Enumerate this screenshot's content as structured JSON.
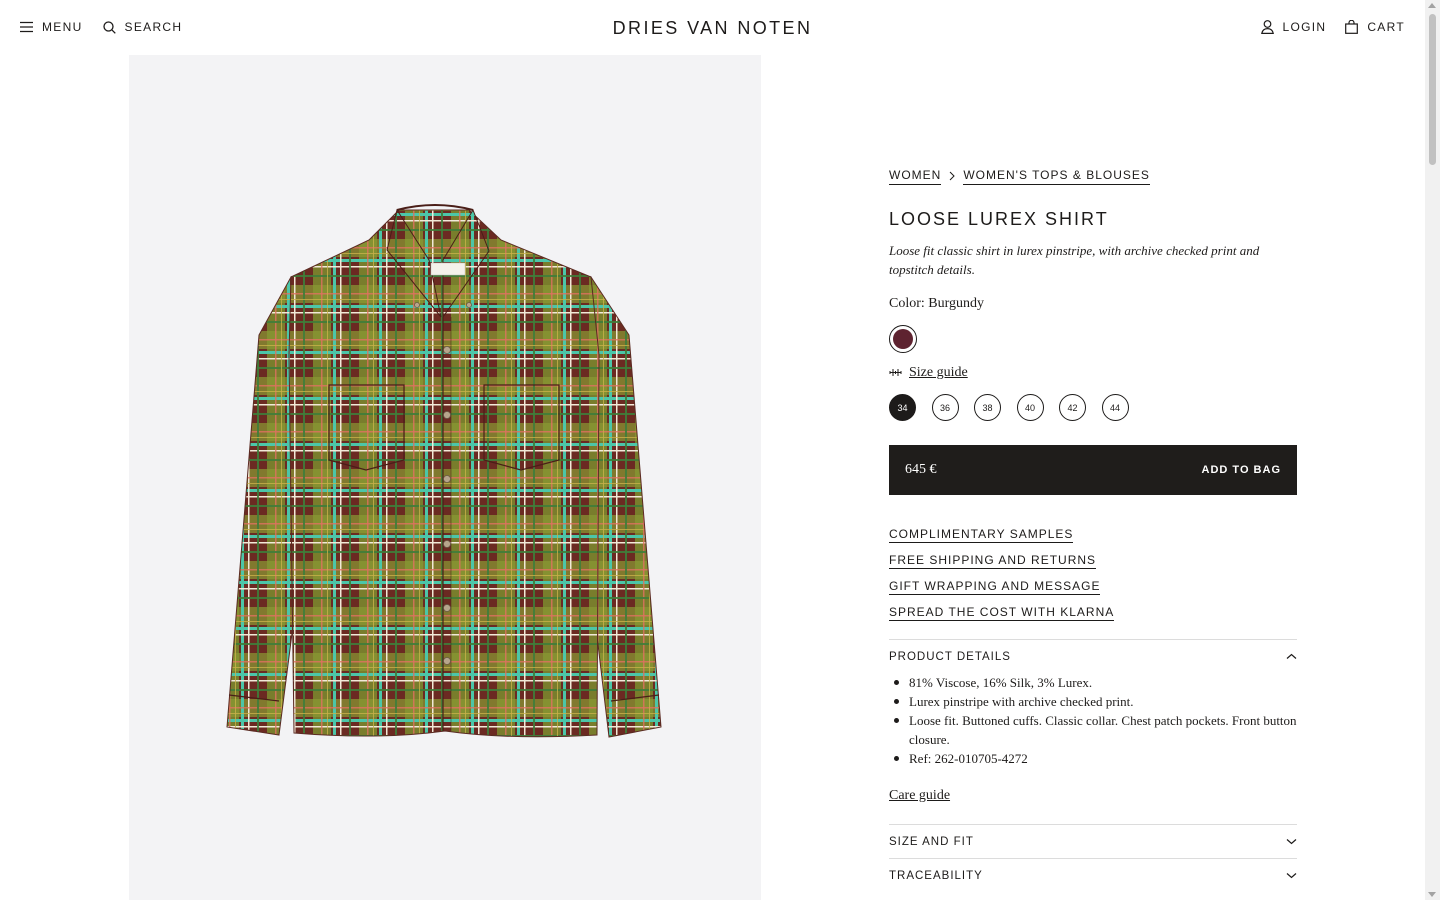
{
  "header": {
    "menu_label": "MENU",
    "search_label": "SEARCH",
    "logo_text": "DRIES VAN NOTEN",
    "login_label": "LOGIN",
    "cart_label": "CART"
  },
  "breadcrumb": {
    "items": [
      "WOMEN",
      "WOMEN'S TOPS & BLOUSES"
    ]
  },
  "product": {
    "title": "LOOSE LUREX SHIRT",
    "description": "Loose fit classic shirt in lurex pinstripe, with archive checked print and topstitch details.",
    "color_label": "Color: Burgundy",
    "swatch_color": "#5e2330",
    "size_guide_label": "Size guide",
    "sizes": [
      "34",
      "36",
      "38",
      "40",
      "42",
      "44"
    ],
    "selected_size": "34",
    "price": "645 €",
    "add_to_bag_label": "ADD TO BAG"
  },
  "services": [
    "COMPLIMENTARY SAMPLES",
    "FREE SHIPPING AND RETURNS",
    "GIFT WRAPPING AND MESSAGE",
    "SPREAD THE COST WITH KLARNA"
  ],
  "accordions": {
    "details": {
      "title": "PRODUCT DETAILS",
      "expanded": true,
      "items": [
        "81% Viscose, 16% Silk, 3% Lurex.",
        "Lurex pinstripe with archive checked print.",
        "Loose fit. Buttoned cuffs. Classic collar. Chest patch pockets. Front button closure.",
        "Ref: 262-010705-4272"
      ],
      "care_label": "Care guide"
    },
    "size_fit": {
      "title": "SIZE AND FIT",
      "expanded": false
    },
    "traceability": {
      "title": "TRACEABILITY",
      "expanded": false
    }
  },
  "icons": {
    "menu": "hamburger-icon",
    "search": "search-icon",
    "login": "user-icon",
    "cart": "bag-icon",
    "breadcrumb_sep": "chevron-right-icon",
    "size_guide": "ruler-icon",
    "expanded": "chevron-up-icon",
    "collapsed": "chevron-down-icon"
  }
}
